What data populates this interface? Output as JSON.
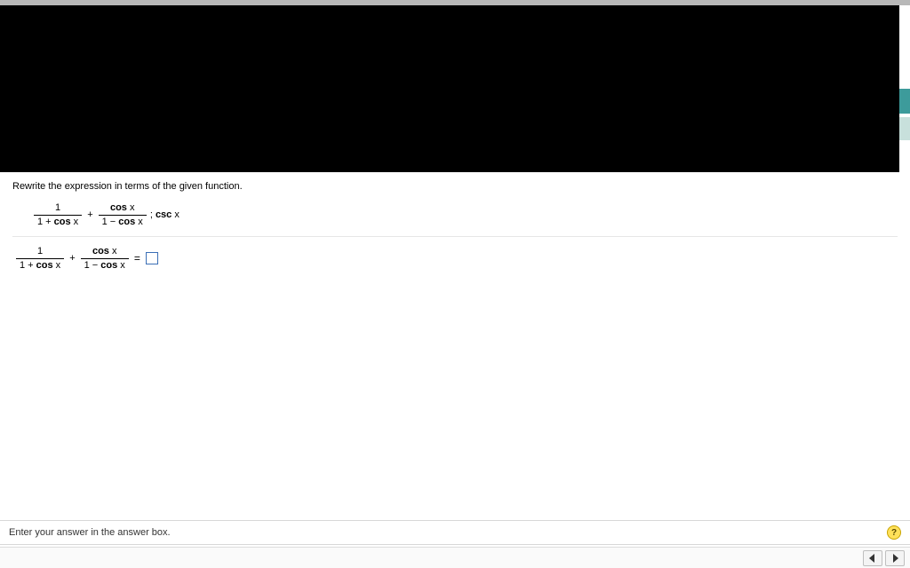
{
  "instruction": "Rewrite the expression in terms of the given function.",
  "expr": {
    "frac1_num": "1",
    "frac1_den_pre": "1 + ",
    "frac1_den_fn": "cos",
    "frac1_den_var": " x",
    "plus": "+",
    "frac2_num_fn": "cos",
    "frac2_num_var": " x",
    "frac2_den_pre": "1 − ",
    "frac2_den_fn": "cos",
    "frac2_den_var": " x",
    "after_sep": "; ",
    "after_fn": "csc",
    "after_var": " x"
  },
  "answer_eq": "=",
  "footer_text": "Enter your answer in the answer box.",
  "help_label": "?"
}
